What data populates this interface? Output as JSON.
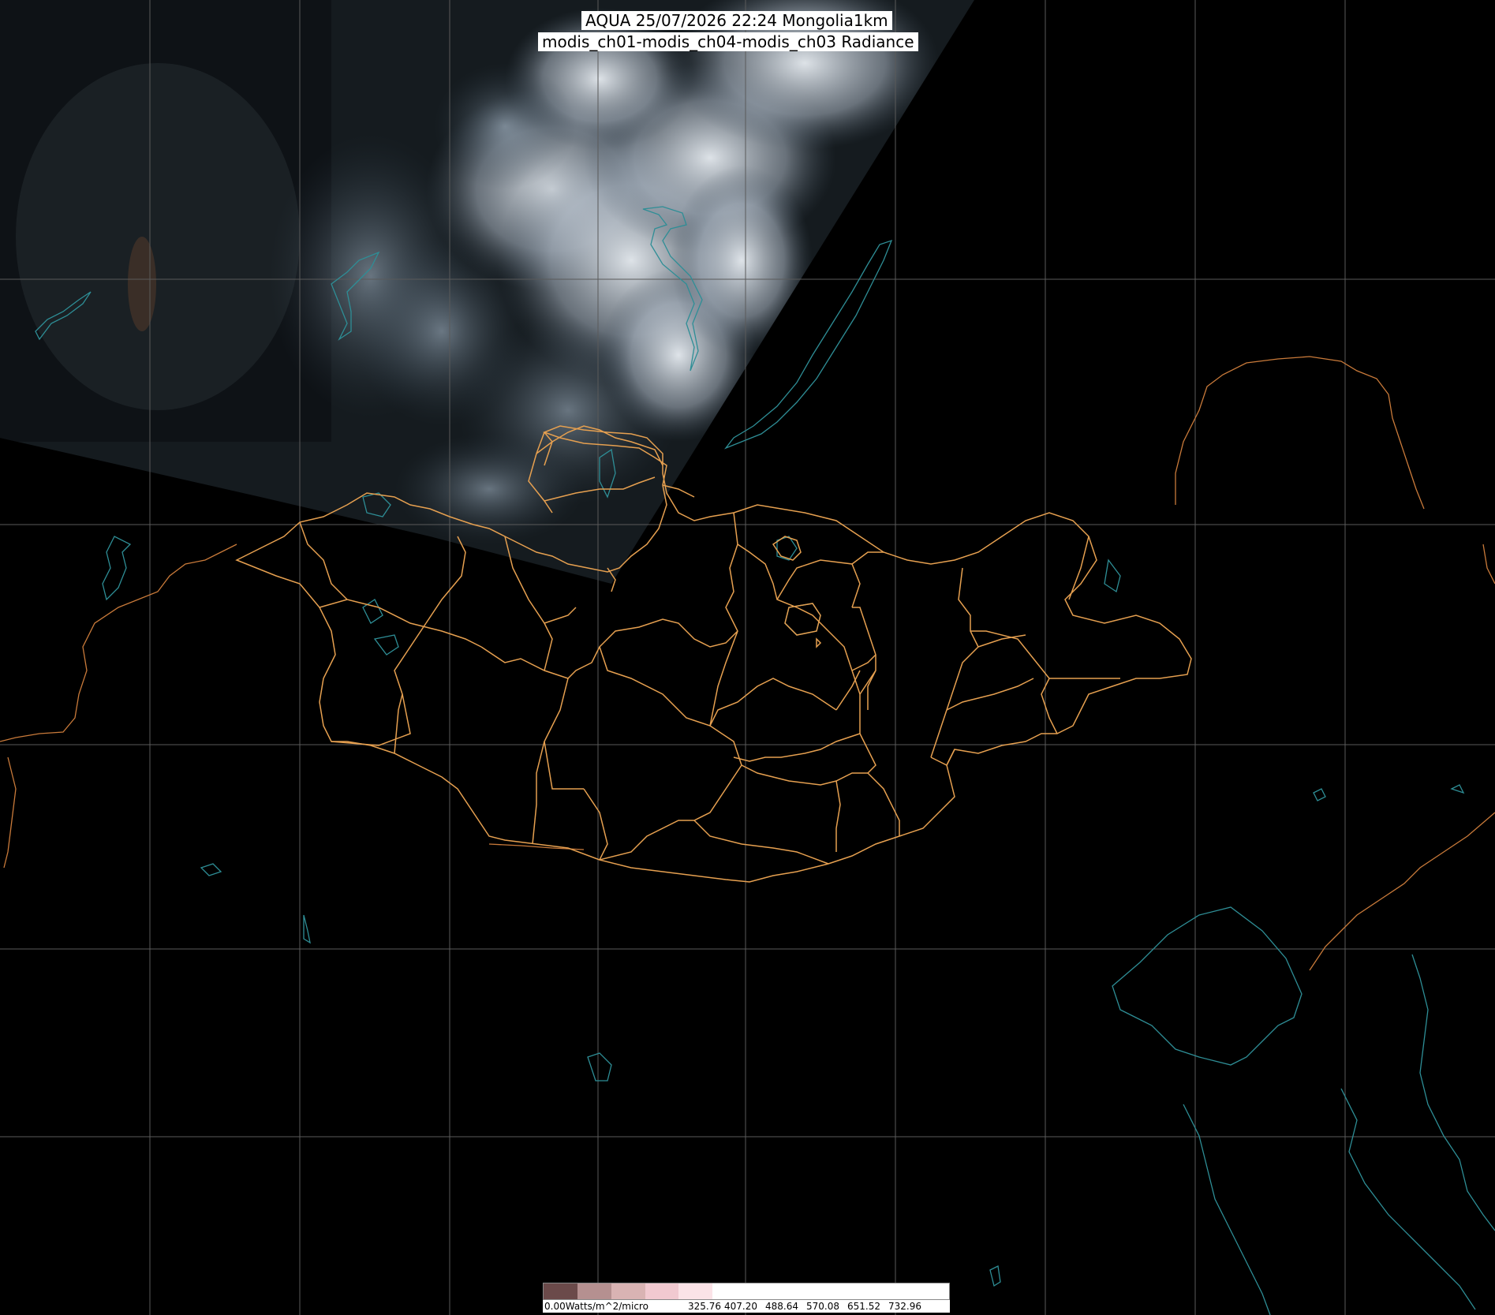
{
  "header": {
    "title_line1": "AQUA 25/07/2026 22:24 Mongolia1km",
    "title_line2": "modis_ch01-modis_ch04-modis_ch03 Radiance"
  },
  "colorbar": {
    "unit_label": "0.00Watts/m^2/micro",
    "ticks": [
      "325.76",
      "407.20",
      "488.64",
      "570.08",
      "651.52",
      "732.96"
    ],
    "segment_colors": [
      "#6b4a4a",
      "#b59090",
      "#d9b3b3",
      "#f1c9d0",
      "#fbe3e7",
      "#ffffff",
      "#ffffff",
      "#ffffff",
      "#ffffff",
      "#ffffff",
      "#ffffff",
      "#ffffff"
    ]
  },
  "colors": {
    "background": "#000000",
    "gridline": "#5a5a5a",
    "admin_border": "#e6a050",
    "coastline": "#2e8e96",
    "international_border": "#c97a3a",
    "cloud": "#d6dde6",
    "land_image": "#1b2226"
  }
}
